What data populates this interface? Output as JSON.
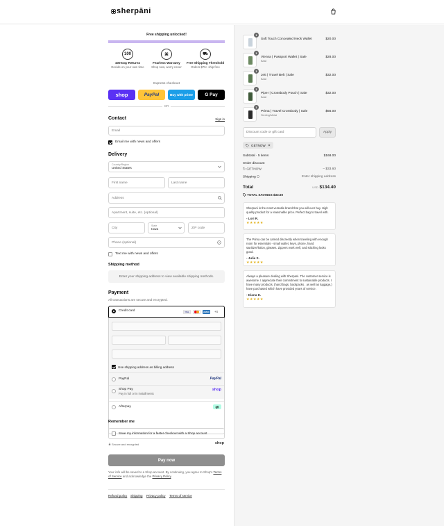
{
  "brand": {
    "name": "sherpani"
  },
  "header": {
    "logo_text": "sherpāni"
  },
  "banner": {
    "text": "Free shipping unlocked!"
  },
  "benefits": [
    {
      "title": "100-Day Returns",
      "subtitle": "Decide on your own time",
      "icon": "badge-100-icon"
    },
    {
      "title": "Fearless Warranty",
      "subtitle": "Shop now, worry never",
      "icon": "warranty-icon"
    },
    {
      "title": "Free Shipping Threshold",
      "subtitle": "Orders $75+ ship free",
      "icon": "truck-icon"
    }
  ],
  "express": {
    "label": "Express checkout",
    "shop": "shop",
    "paypal": "PayPal",
    "amazon": "Buy with prime",
    "gpay": "G Pay",
    "or": "OR"
  },
  "contact": {
    "title": "Contact",
    "sign_in": "Sign in",
    "email_placeholder": "Email",
    "newsletter": "Email me with news and offers"
  },
  "delivery": {
    "title": "Delivery",
    "country_label": "Country/Region",
    "country_value": "United States",
    "first_name": "First name",
    "last_name": "Last name",
    "address": "Address",
    "apartment": "Apartment, suite, etc. (optional)",
    "city": "City",
    "state_label": "State",
    "state_value": "Iowa",
    "zip": "ZIP code",
    "phone": "Phone (optional)",
    "text_me": "Text me with news and offers"
  },
  "shipping_method": {
    "title": "Shipping method",
    "note": "Enter your shipping address to view available shipping methods."
  },
  "payment": {
    "title": "Payment",
    "subtitle": "All transactions are secure and encrypted.",
    "credit_card": "Credit card",
    "more_cards": "+4",
    "card_brands": [
      "VISA",
      "MC",
      "AMEX"
    ],
    "billing_same": "Use shipping address as billing address",
    "paypal": "PayPal",
    "paypal_logo": "PayPal",
    "shop_pay": "Shop Pay",
    "shop_pay_sub": "Pay in full or in installments",
    "shop_logo": "shop",
    "afterpay": "Afterpay"
  },
  "remember": {
    "title": "Remember me",
    "save_info": "Save my information for a faster checkout with a Shop account",
    "secure": "Secure and encrypted",
    "shop_logo": "shop"
  },
  "pay_now": "Pay now",
  "legal": {
    "line1": "Your info will be saved to a Shop account. By continuing, you agree to Shop's",
    "terms": "Terms of Service",
    "mid": "and acknowledge the",
    "privacy": "Privacy Policy",
    "end": "."
  },
  "footer_links": [
    "Refund policy",
    "Shipping",
    "Privacy policy",
    "Terms of service"
  ],
  "cart": {
    "items": [
      {
        "name": "Soft Touch Concealed Neck Wallet",
        "variant": "",
        "price": "$20.00",
        "qty": "1",
        "color": "#c9d3dc"
      },
      {
        "name": "Vienna | Passport Wallet | Sale",
        "variant": "Basil",
        "price": "$28.00",
        "qty": "1",
        "color": "#6d8a62"
      },
      {
        "name": "Jett | Travel Belt | Sale",
        "variant": "Basil",
        "price": "$32.00",
        "qty": "1",
        "color": "#5b7a52"
      },
      {
        "name": "Piper | Crossbody Pouch | Sale",
        "variant": "Basil",
        "price": "$32.00",
        "qty": "1",
        "color": "#3f5a3a"
      },
      {
        "name": "Prima | Travel Crossbody | Sale",
        "variant": "Sterling/Metal",
        "price": "$56.00",
        "qty": "1",
        "color": "#2b2b2b"
      }
    ],
    "discount_placeholder": "Discount code or gift card",
    "apply": "Apply",
    "code_tag": "GETNOW",
    "subtotal_label": "Subtotal · 5 items",
    "subtotal_value": "$168.00",
    "order_discount": "Order discount",
    "discount_code": "GETNOW",
    "discount_value": "– $33.60",
    "shipping_label": "Shipping",
    "shipping_value": "Enter shipping address",
    "total_label": "Total",
    "currency": "USD",
    "total_value": "$134.40",
    "savings_label": "TOTAL SAVINGS",
    "savings_value": "$33.60"
  },
  "reviews": [
    {
      "text": "Sherpani is the most versatile brand that you will ever buy. High quality product for a reasonable price. Perfect bag to travel with.",
      "author": "- Lori R.",
      "stars": "★★★★★"
    },
    {
      "text": "The Prima can be carried discreetly when traveling with enough room for essentials - small wallet, keys, phone, hand sanitizer/lotion, glasses. Zippers work well, and stitching looks good.",
      "author": "- Julie S.",
      "stars": "★★★★★"
    },
    {
      "text": "Always a pleasure dealing with Sherpani. The customer service is awesome. I appreciate their commitment to sustainable products. I have many products, (hand bags, backpacks , as well as luggage,) have purchased which have provided years of service.",
      "author": "- Diana D.",
      "stars": "★★★★★"
    }
  ],
  "colors": {
    "shop": "#5a31f4",
    "paypal": "#ffc439",
    "amazon": "#1b9ee8",
    "gpay": "#000000",
    "accent_bar": "#c9b6f0",
    "pay_now": "#8e8e8e"
  }
}
